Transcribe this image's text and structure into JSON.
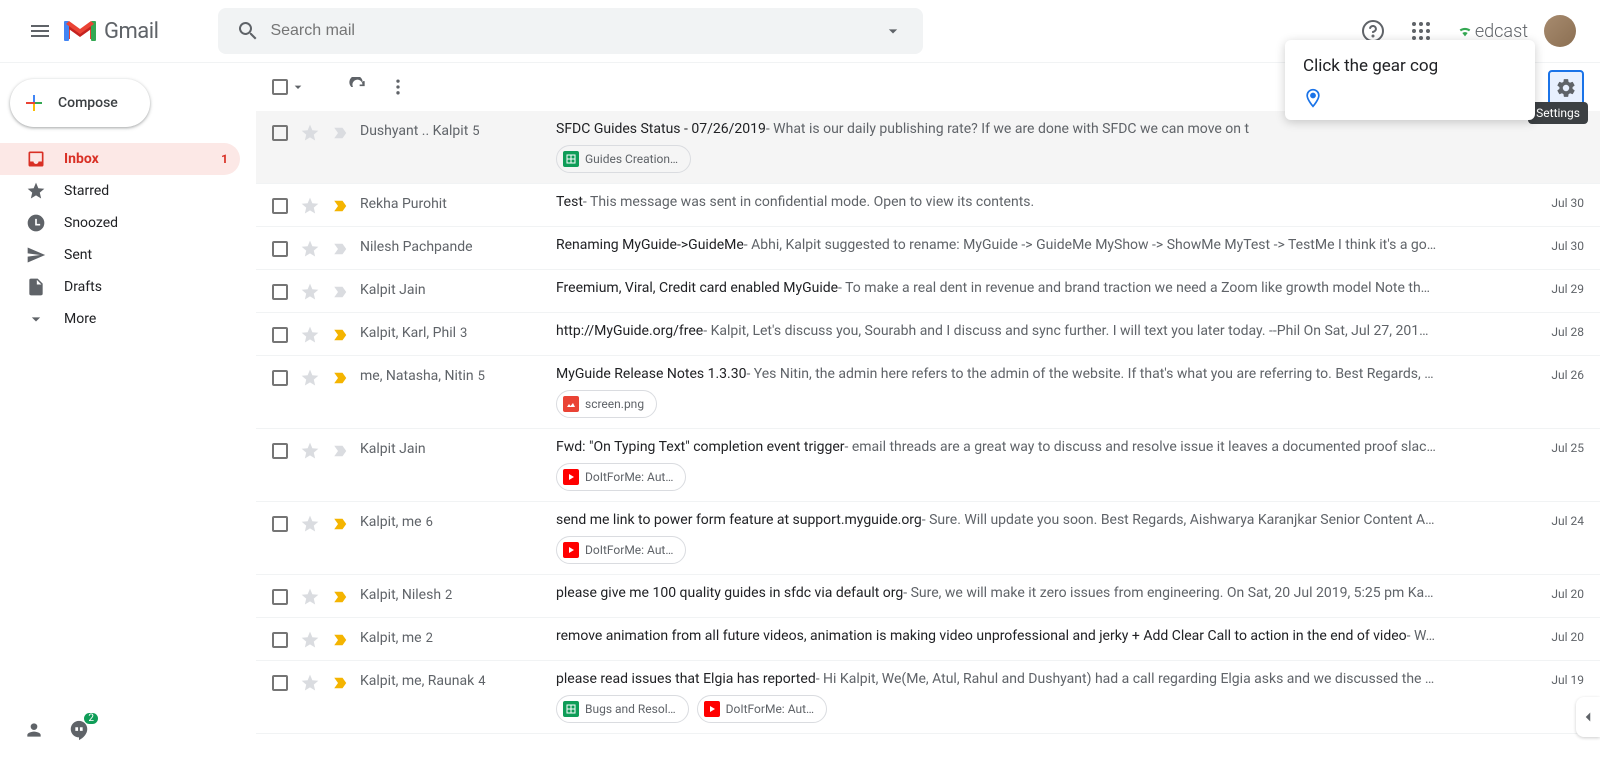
{
  "header": {
    "product": "Gmail",
    "search_placeholder": "Search mail",
    "brand": "edcast"
  },
  "tooltip": {
    "text": "Click the gear cog",
    "label": "Settings"
  },
  "compose": {
    "label": "Compose"
  },
  "nav": {
    "inbox": "Inbox",
    "inbox_count": "1",
    "starred": "Starred",
    "snoozed": "Snoozed",
    "sent": "Sent",
    "drafts": "Drafts",
    "more": "More"
  },
  "hangouts_badge": "2",
  "emails": [
    {
      "sender": "Dushyant .. Kalpit",
      "count": "5",
      "subject": "SFDC Guides Status - 07/26/2019",
      "snippet": " - What is our daily publishing rate? If we are done with SFDC we can move on t",
      "date": "",
      "important": false,
      "attachments": [
        {
          "type": "sheets",
          "label": "Guides Creation…"
        }
      ]
    },
    {
      "sender": "Rekha Purohit",
      "count": "",
      "subject": "Test",
      "snippet": " - This message was sent in confidential mode. Open to view its contents.",
      "date": "Jul 30",
      "important": true,
      "attachments": []
    },
    {
      "sender": "Nilesh Pachpande",
      "count": "",
      "subject": "Renaming MyGuide->GuideMe",
      "snippet": " - Abhi, Kalpit suggested to rename: MyGuide -> GuideMe MyShow -> ShowMe MyTest -> TestMe I think it's a go…",
      "date": "Jul 30",
      "important": false,
      "attachments": []
    },
    {
      "sender": "Kalpit Jain",
      "count": "",
      "subject": "Freemium, Viral, Credit card enabled MyGuide",
      "snippet": " - To make a real dent in revenue and brand traction we need a Zoom like growth model Note th…",
      "date": "Jul 29",
      "important": false,
      "attachments": []
    },
    {
      "sender": "Kalpit, Karl, Phil",
      "count": "3",
      "subject": "http://MyGuide.org/free",
      "snippet": " - Kalpit, Let's discuss you, Sourabh and I discuss and sync further. I will text you later today. --Phil On Sat, Jul 27, 201…",
      "date": "Jul 28",
      "important": true,
      "attachments": []
    },
    {
      "sender": "me, Natasha, Nitin",
      "count": "5",
      "subject": "MyGuide Release Notes 1.3.30",
      "snippet": " - Yes Nitin, the admin here refers to the admin of the website. If that's what you are referring to. Best Regards, …",
      "date": "Jul 26",
      "important": true,
      "attachments": [
        {
          "type": "img",
          "label": "screen.png"
        }
      ]
    },
    {
      "sender": "Kalpit Jain",
      "count": "",
      "subject": "Fwd: \"On Typing Text\" completion event trigger",
      "snippet": " - email threads are a great way to discuss and resolve issue it leaves a documented proof slac…",
      "date": "Jul 25",
      "important": false,
      "attachments": [
        {
          "type": "yt",
          "label": "DoItForMe: Aut…"
        }
      ]
    },
    {
      "sender": "Kalpit, me",
      "count": "6",
      "subject": "send me link to power form feature at support.myguide.org",
      "snippet": " - Sure. Will update you soon. Best Regards, Aishwarya Karanjkar Senior Content A…",
      "date": "Jul 24",
      "important": true,
      "attachments": [
        {
          "type": "yt",
          "label": "DoItForMe: Aut…"
        }
      ]
    },
    {
      "sender": "Kalpit, Nilesh",
      "count": "2",
      "subject": "please give me 100 quality guides in sfdc via default org",
      "snippet": " - Sure, we will make it zero issues from engineering. On Sat, 20 Jul 2019, 5:25 pm Ka…",
      "date": "Jul 20",
      "important": true,
      "attachments": []
    },
    {
      "sender": "Kalpit, me",
      "count": "2",
      "subject": "remove animation from all future videos, animation is making video unprofessional and jerky + Add Clear Call to action in the end of video",
      "snippet": " - W…",
      "date": "Jul 20",
      "important": true,
      "attachments": []
    },
    {
      "sender": "Kalpit, me, Raunak",
      "count": "4",
      "subject": "please read issues that Elgia has reported",
      "snippet": " - Hi Kalpit, We(Me, Atul, Rahul and Dushyant) had a call regarding Elgia asks and we discussed the …",
      "date": "Jul 19",
      "important": true,
      "attachments": [
        {
          "type": "sheets",
          "label": "Bugs and Resol…"
        },
        {
          "type": "yt",
          "label": "DoItForMe: Aut…"
        }
      ]
    }
  ]
}
